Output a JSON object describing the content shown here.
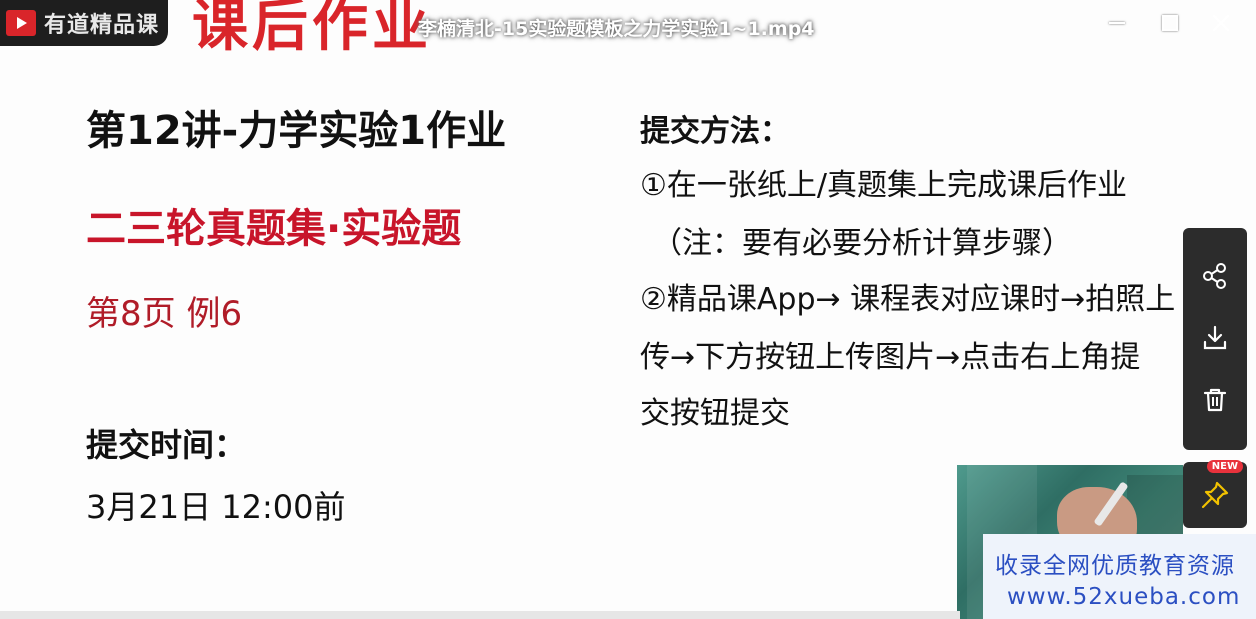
{
  "window": {
    "title": "李楠清北-15实验题模板之力学实验1~1.mp4",
    "minimize_icon": "minimize-icon",
    "maximize_icon": "maximize-icon",
    "close_icon": "close-icon",
    "close_symbol": "✕"
  },
  "slide": {
    "brand": "有道精品课",
    "heading": "课后作业",
    "lecture_title": "第12讲-力学实验1作业",
    "book_title": "二三轮真题集·实验题",
    "page_ref": "第8页 例6",
    "deadline_label": "提交时间：",
    "deadline_value": "3月21日 12:00前",
    "method_label": "提交方法：",
    "method_lines": [
      "①在一张纸上/真题集上完成课后作业",
      "（注：要有必要分析计算步骤）",
      "②精品课App→ 课程表对应课时→拍照上",
      "传→下方按钮上传图片→点击右上角提",
      "交按钮提交"
    ]
  },
  "toolbar": {
    "items": [
      {
        "icon": "share-icon"
      },
      {
        "icon": "download-icon"
      },
      {
        "icon": "trash-icon"
      }
    ],
    "pin": {
      "icon": "pin-icon",
      "badge": "NEW"
    }
  },
  "watermark": {
    "line1": "收录全网优质教育资源",
    "line2": "www.52xueba.com"
  },
  "colors": {
    "accent_red": "#d9252a",
    "toolbar_bg": "#2c2c2c",
    "watermark_blue": "#2b4fc2"
  }
}
